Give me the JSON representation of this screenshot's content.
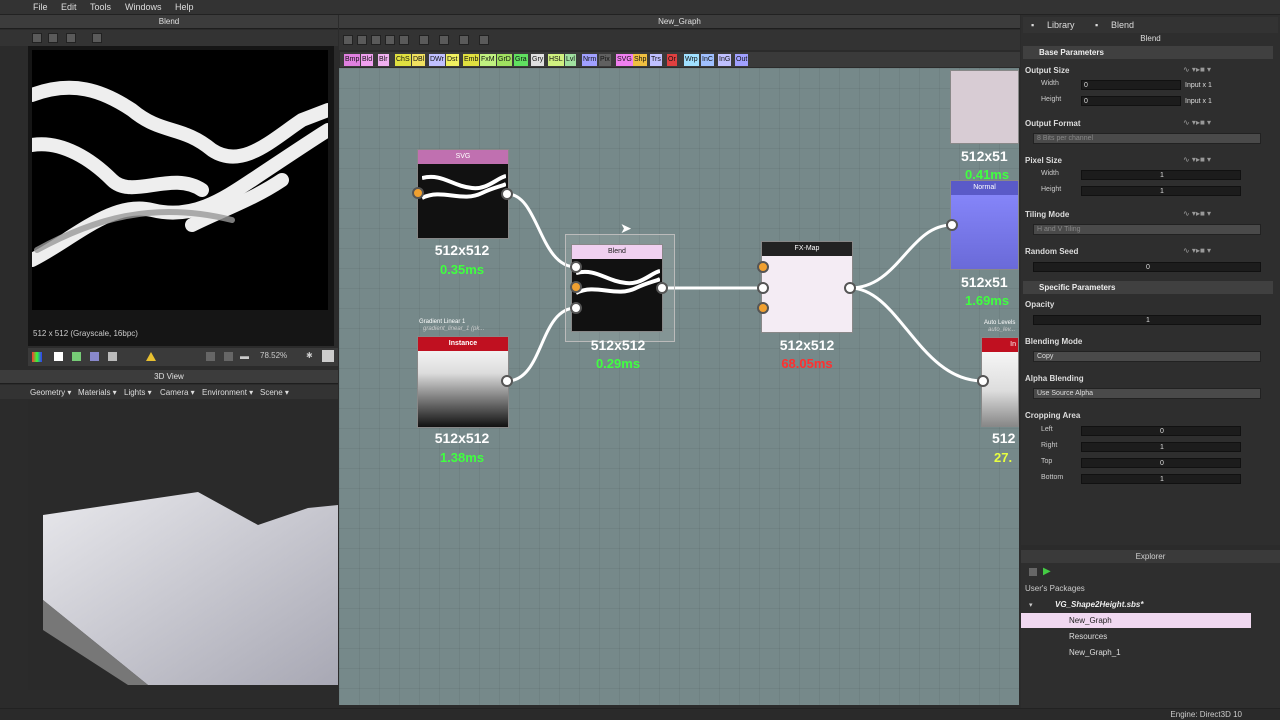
{
  "menu": [
    "File",
    "Edit",
    "Tools",
    "Windows",
    "Help"
  ],
  "panels": {
    "view2d_title": "Blend",
    "graph_title": "New_Graph",
    "view3d_title": "3D View",
    "library_tab": "Library",
    "blend_tab": "Blend",
    "params_title": "Blend",
    "explorer_title": "Explorer"
  },
  "view2d": {
    "info": "512 x 512 (Grayscale, 16bpc)",
    "zoom": "78.52%"
  },
  "view3d": {
    "menu": [
      "Geometry ▾",
      "Materials ▾",
      "Lights ▾",
      "Camera ▾",
      "Environment ▾",
      "Scene ▾"
    ]
  },
  "palette": [
    {
      "label": "Bmp",
      "color": "#e080e0"
    },
    {
      "label": "Bld",
      "color": "#f0a0f0"
    },
    {
      "label": "Blr",
      "color": "#f0b0f0"
    },
    {
      "label": "ChS",
      "color": "#e0e040"
    },
    {
      "label": "DBl",
      "color": "#f0e060"
    },
    {
      "label": "DWr",
      "color": "#c0c0ff"
    },
    {
      "label": "Dst",
      "color": "#f0f060"
    },
    {
      "label": "Emb",
      "color": "#e0e040"
    },
    {
      "label": "FxM",
      "color": "#c0f080"
    },
    {
      "label": "GrD",
      "color": "#a0e060"
    },
    {
      "label": "Gra",
      "color": "#60e060"
    },
    {
      "label": "Gry",
      "color": "#e0e0e0"
    },
    {
      "label": "HSL",
      "color": "#d0f080"
    },
    {
      "label": "Lvl",
      "color": "#a0e0a0"
    },
    {
      "label": "Nrm",
      "color": "#a0a0ff"
    },
    {
      "label": "Pix",
      "color": "#606060"
    },
    {
      "label": "SVG",
      "color": "#f080f0"
    },
    {
      "label": "Shp",
      "color": "#f0c040"
    },
    {
      "label": "Trs",
      "color": "#c0c0ff"
    },
    {
      "label": "Or",
      "color": "#e04040"
    },
    {
      "label": "Wrp",
      "color": "#a0e0ff"
    },
    {
      "label": "InC",
      "color": "#a0c0ff"
    },
    {
      "label": "InG",
      "color": "#c0c0ff"
    },
    {
      "label": "Out",
      "color": "#a0a0ff"
    }
  ],
  "nodes": {
    "svg": {
      "title": "SVG",
      "size": "512x512",
      "time": "0.35ms"
    },
    "gradient": {
      "label": "Gradient Linear 1",
      "sublabel": "gradient_linear_1 (pk...",
      "title": "Instance",
      "size": "512x512",
      "time": "1.38ms"
    },
    "blend": {
      "title": "Blend",
      "size": "512x512",
      "time": "0.29ms"
    },
    "fxmap": {
      "title": "FX-Map",
      "size": "512x512",
      "time": "68.05ms"
    },
    "top_right": {
      "size": "512x51",
      "time": "0.41ms"
    },
    "normal": {
      "title": "Normal",
      "size": "512x51",
      "time": "1.69ms"
    },
    "auto_levels": {
      "label": "Auto Levels",
      "sublabel": "auto_lev...",
      "title": "In",
      "size": "512",
      "time": "27."
    }
  },
  "colors": {
    "time_green": "#40ff40",
    "time_red": "#ff3030",
    "time_yellow": "#e8ff40",
    "instance_red": "#c01020",
    "svg_pink": "#c070b0"
  },
  "params": {
    "base_header": "Base Parameters",
    "output_size": "Output Size",
    "width_label": "Width",
    "height_label": "Height",
    "width_value": "0",
    "height_value": "0",
    "width_mode": "Input x 1",
    "height_mode": "Input x 1",
    "output_format": "Output Format",
    "output_format_value": "8 Bits per channel",
    "pixel_size": "Pixel Size",
    "pixel_width_value": "1",
    "pixel_height_value": "1",
    "tiling_mode": "Tiling Mode",
    "tiling_value": "H and V Tiling",
    "random_seed": "Random Seed",
    "seed_value": "0",
    "specific_header": "Specific Parameters",
    "opacity": "Opacity",
    "opacity_value": "1",
    "blending_mode": "Blending Mode",
    "blending_value": "Copy",
    "alpha_blending": "Alpha Blending",
    "alpha_value": "Use Source Alpha",
    "cropping": "Cropping Area",
    "left": "Left",
    "left_value": "0",
    "right": "Right",
    "right_value": "1",
    "top": "Top",
    "top_value": "0",
    "bottom": "Bottom",
    "bottom_value": "1"
  },
  "explorer": {
    "section": "User's Packages",
    "package": "VG_Shape2Height.sbs*",
    "items": [
      "New_Graph",
      "Resources",
      "New_Graph_1"
    ]
  },
  "status": {
    "engine": "Engine: Direct3D 10"
  }
}
